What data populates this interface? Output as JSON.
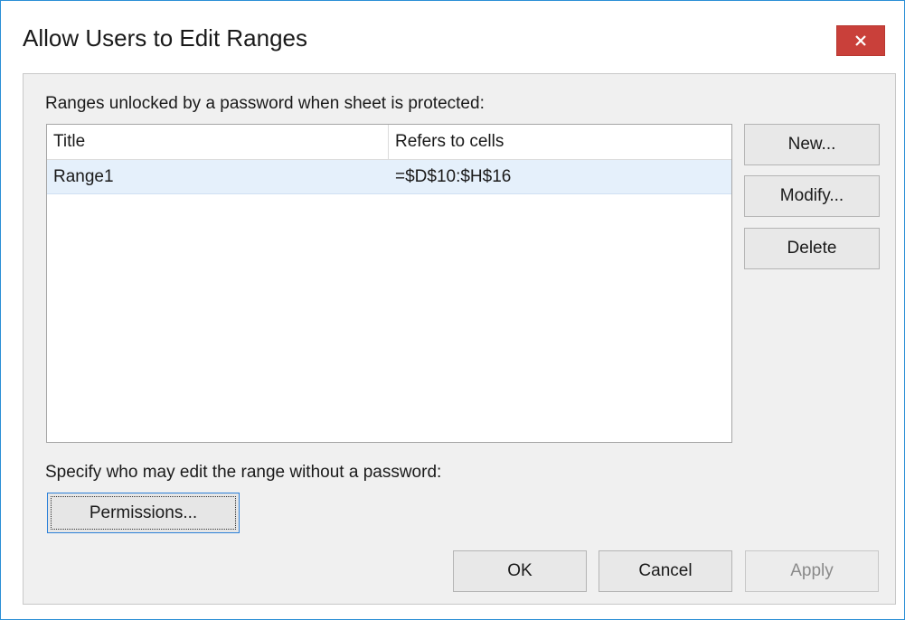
{
  "window": {
    "title": "Allow Users to Edit Ranges",
    "close_symbol": "✕",
    "close_icon": "close-icon",
    "accent_color": "#2b8fd6",
    "close_color": "#c9403a"
  },
  "ranges_label": "Ranges unlocked by a password when sheet is protected:",
  "table": {
    "columns": [
      "Title",
      "Refers to cells"
    ],
    "rows": [
      {
        "title": "Range1",
        "refers_to": "=$D$10:$H$16",
        "selected": true
      }
    ]
  },
  "side_buttons": {
    "new_label": "New...",
    "modify_label": "Modify...",
    "delete_label": "Delete"
  },
  "permissions_label": "Specify who may edit the range without a password:",
  "permissions_button": "Permissions...",
  "footer": {
    "ok_label": "OK",
    "cancel_label": "Cancel",
    "apply_label": "Apply",
    "apply_enabled": false
  }
}
